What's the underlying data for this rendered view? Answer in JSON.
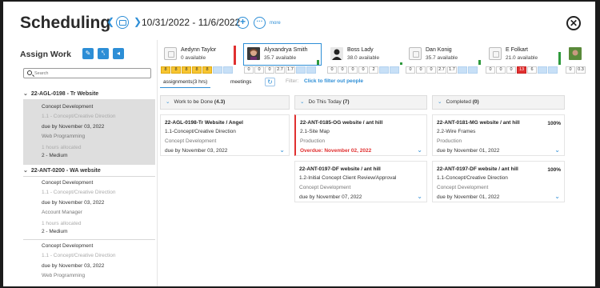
{
  "header": {
    "title": "Scheduling",
    "prev_icon": "chevron-left-icon",
    "next_icon": "chevron-right-icon",
    "date_range": "10/31/2022 - 11/6/2022",
    "add_label": "+",
    "more_label": "more",
    "close_label": "✕"
  },
  "sidebar": {
    "title": "Assign Work",
    "search_placeholder": "Search",
    "projects": [
      {
        "name": "22-AGL-0198 - Tr Website",
        "tasks": [
          {
            "name": "Concept Development",
            "phase": "1.1 - Concept/Creative Direction",
            "due": "due by November 03, 2022",
            "role": "Web Programming",
            "allocated": "1 hours allocated",
            "priority": "2 - Medium"
          }
        ]
      },
      {
        "name": "22-ANT-0200 - WA website",
        "tasks": [
          {
            "name": "Concept Development",
            "phase": "1.1 - Concept/Creative Direction",
            "due": "due by November 03, 2022",
            "role": "Account Manager",
            "allocated": "1 hours allocated",
            "priority": "2 - Medium"
          },
          {
            "name": "Concept Development",
            "phase": "1.1 - Concept/Creative Direction",
            "due": "due by November 03, 2022",
            "role": "Web Programming"
          }
        ]
      }
    ]
  },
  "people": [
    {
      "name": "Aedynn Taylor",
      "available": "0 available",
      "bar_color": "#e03030",
      "cells": [
        "8",
        "8",
        "8",
        "8",
        "8"
      ],
      "cell_styles": [
        "y",
        "y",
        "y",
        "y",
        "y"
      ]
    },
    {
      "name": "Alyxandrya Smith",
      "available": "35.7 available",
      "bar_color": "#2e9a3c",
      "cells": [
        "0",
        "0",
        "0",
        "2.7",
        "1.7"
      ],
      "cell_styles": [
        "",
        "",
        "",
        "",
        ""
      ]
    },
    {
      "name": "Boss Lady",
      "available": "38.0 available",
      "bar_color": "#2e9a3c",
      "cells": [
        "0",
        "0",
        "0",
        "0",
        "2"
      ],
      "cell_styles": [
        "",
        "",
        "",
        "",
        ""
      ]
    },
    {
      "name": "Dan Konig",
      "available": "35.7 available",
      "bar_color": "#2e9a3c",
      "cells": [
        "0",
        "0",
        "0",
        "2.7",
        "1.7"
      ],
      "cell_styles": [
        "",
        "",
        "",
        "",
        ""
      ]
    },
    {
      "name": "E Folkart",
      "available": "21.0 available",
      "bar_color": "#2e9a3c",
      "cells": [
        "0",
        "0",
        "0",
        "13",
        "6"
      ],
      "cell_styles": [
        "",
        "",
        "",
        "r",
        ""
      ]
    },
    {
      "name": "",
      "available": "",
      "bar_color": "#2e9a3c",
      "cells": [
        "0",
        "0.3"
      ],
      "cell_styles": [
        "",
        ""
      ]
    }
  ],
  "tabs": {
    "assignments": "assignments(3 hrs)",
    "meetings": "meetings",
    "refresh_icon": "refresh-icon",
    "filter_label": "Filter:",
    "filter_link": "Click to filter out people"
  },
  "columns": [
    {
      "title": "Work to be Done",
      "count": "(4.3)",
      "cards": [
        {
          "title": "22-AGL-0198-Tr Website / Angel",
          "phase": "1.1-Concept/Creative Direction",
          "task": "Concept Development",
          "due": "due by November 03, 2022",
          "percent": ""
        }
      ]
    },
    {
      "title": "Do This Today",
      "count": "(7)",
      "cards": [
        {
          "title": "22-ANT-0185-OG website / ant hill",
          "phase": "2.1-Site Map",
          "task": "Production",
          "due": "Overdue: November 02, 2022",
          "percent": ""
        },
        {
          "title": "22-ANT-0197-DF website / ant hill",
          "phase": "1.2-Initial Concept Client Review/Approval",
          "task": "Concept Development",
          "due": "due by November 07, 2022",
          "percent": ""
        }
      ]
    },
    {
      "title": "Completed",
      "count": "(0)",
      "cards": [
        {
          "title": "22-ANT-0181-MG website / ant hill",
          "phase": "2.2-Wire Frames",
          "task": "Production",
          "due": "due by November 01, 2022",
          "percent": "100%"
        },
        {
          "title": "22-ANT-0197-DF website / ant hill",
          "phase": "1.1-Concept/Creative Direction",
          "task": "Concept Development",
          "due": "due by November 01, 2022",
          "percent": "100%"
        }
      ]
    }
  ],
  "colors": {
    "accent": "#2d8ed6",
    "overdue": "#e03030",
    "warning_cell": "#f7c531"
  }
}
